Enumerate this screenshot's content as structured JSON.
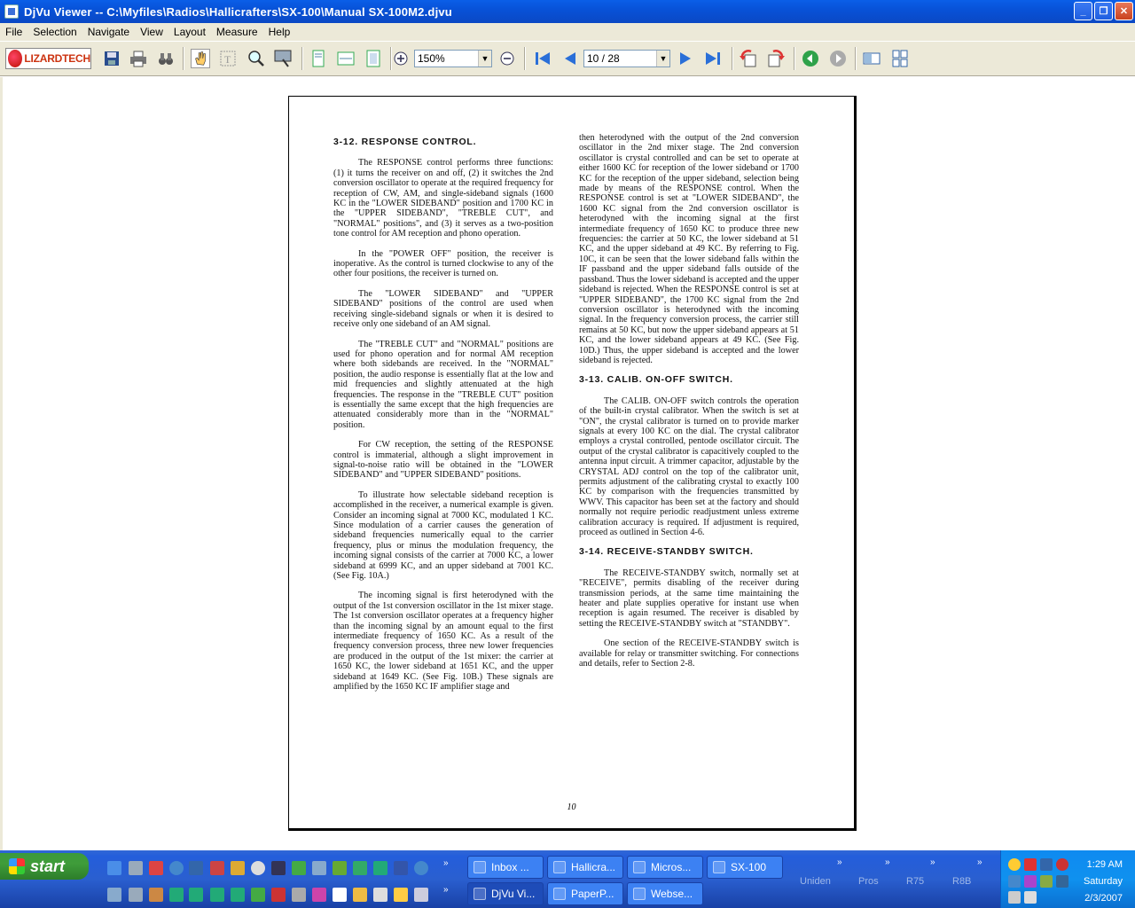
{
  "window": {
    "title": "DjVu Viewer -- C:\\Myfiles\\Radios\\Hallicrafters\\SX-100\\Manual SX-100M2.djvu",
    "minimize": "_",
    "maximize": "❐",
    "close": "✕"
  },
  "menu": [
    "File",
    "Selection",
    "Navigate",
    "View",
    "Layout",
    "Measure",
    "Help"
  ],
  "toolbar": {
    "logo_text": "LIZARDTECH",
    "zoom_value": "150%",
    "page_value": "10 / 28"
  },
  "document": {
    "page_number": "10",
    "left_column": [
      {
        "type": "h",
        "text": "3-12.  RESPONSE CONTROL."
      },
      {
        "type": "p",
        "text": "The RESPONSE control performs three functions: (1) it turns the receiver on and off, (2) it switches the 2nd conversion oscillator to operate at the required frequency for reception of CW, AM, and single-sideband signals (1600 KC in the \"LOWER SIDEBAND\" position and 1700 KC in the \"UPPER SIDEBAND\", \"TREBLE CUT\", and \"NORMAL\" positions\", and (3) it serves as a two-position tone control for AM reception and phono operation."
      },
      {
        "type": "p",
        "text": "In the \"POWER OFF\" position, the receiver is inoperative. As the control is turned clockwise to any of the other four positions, the receiver is turned on."
      },
      {
        "type": "p",
        "text": "The \"LOWER SIDEBAND\" and \"UPPER SIDEBAND\" positions of the control are used when receiving single-sideband signals or when it is desired to receive only one sideband of an AM signal."
      },
      {
        "type": "p",
        "text": "The \"TREBLE CUT\" and \"NORMAL\" positions are used for phono operation and for normal AM reception where both sidebands are received. In the \"NORMAL\" position, the audio response is essentially flat at the low and mid frequencies and slightly attenuated at the high frequencies. The response in the \"TREBLE CUT\" position is essentially the same except that the high frequencies are attenuated considerably more than in the \"NORMAL\" position."
      },
      {
        "type": "p",
        "text": "For CW reception, the setting of the RESPONSE control is immaterial, although a slight improvement in signal-to-noise ratio will be obtained in the \"LOWER SIDEBAND\" and \"UPPER SIDEBAND\" positions."
      },
      {
        "type": "p",
        "text": "To illustrate how selectable sideband reception is accomplished in the receiver, a numerical example is given. Consider an incoming signal at 7000 KC, modulated 1 KC. Since modulation of a carrier causes the generation of sideband frequencies numerically equal to the carrier frequency, plus or minus the modulation frequency, the incoming signal consists of the carrier at 7000 KC, a lower sideband at 6999 KC, and an upper sideband at 7001 KC. (See Fig. 10A.)"
      },
      {
        "type": "p",
        "text": "The incoming signal is first heterodyned with the output of the 1st conversion oscillator in the 1st mixer stage. The 1st conversion oscillator operates at a frequency higher than the incoming signal by an amount equal to the first intermediate frequency of 1650 KC. As a result of the frequency conversion process, three new lower frequencies are produced in the output of the 1st mixer: the carrier at 1650 KC, the lower sideband at 1651 KC, and the upper sideband at 1649 KC. (See Fig. 10B.) These signals are amplified by the 1650 KC IF amplifier stage and"
      }
    ],
    "right_column": [
      {
        "type": "p0",
        "text": "then heterodyned with the output of the 2nd conversion oscillator in the 2nd mixer stage. The 2nd conversion oscillator is crystal controlled and can be set to operate at either 1600 KC for reception of the lower sideband or 1700 KC for the reception of the upper sideband, selection being made by means of the RESPONSE control. When the RESPONSE control is set at \"LOWER SIDEBAND\", the 1600 KC signal from the 2nd conversion oscillator is heterodyned with the incoming signal at the first intermediate frequency of 1650 KC to produce three new frequencies: the carrier at 50 KC, the lower sideband at 51 KC, and the upper sideband at 49 KC. By referring to Fig. 10C, it can be seen that the lower sideband falls within the IF passband and the upper sideband falls outside of the passband. Thus the lower sideband is accepted and the upper sideband is rejected. When the RESPONSE control is set at \"UPPER SIDEBAND\", the 1700 KC signal from the 2nd conversion oscillator is heterodyned with the incoming signal. In the frequency conversion process, the carrier still remains at 50 KC, but now the upper sideband appears at 51 KC, and the lower sideband appears at 49 KC. (See Fig. 10D.) Thus, the upper sideband is accepted and the lower sideband is rejected."
      },
      {
        "type": "h",
        "text": "3-13.  CALIB. ON-OFF SWITCH."
      },
      {
        "type": "p",
        "text": "The CALIB. ON-OFF switch controls the operation of the built-in crystal calibrator. When the switch is set at \"ON\", the crystal calibrator is turned on to provide marker signals at every 100 KC on the dial. The crystal calibrator employs a crystal controlled, pentode oscillator circuit. The output of the crystal calibrator is capacitively coupled to the antenna input circuit. A trimmer capacitor, adjustable by the CRYSTAL ADJ control on the top of the calibrator unit, permits adjustment of the calibrating crystal to exactly 100 KC by comparison with the frequencies transmitted by WWV. This capacitor has been set at the factory and should normally not require periodic readjustment unless extreme calibration accuracy is required. If adjustment is required, proceed as outlined in Section 4-6."
      },
      {
        "type": "h",
        "text": "3-14.  RECEIVE-STANDBY SWITCH."
      },
      {
        "type": "p",
        "text": "The RECEIVE-STANDBY switch, normally set at \"RECEIVE\", permits disabling of the receiver during transmission periods, at the same time maintaining the heater and plate supplies operative for instant use when reception is again resumed. The receiver is disabled by setting the RECEIVE-STANDBY switch at \"STANDBY\"."
      },
      {
        "type": "p",
        "text": "One section of the RECEIVE-STANDBY switch is available for relay or transmitter switching. For connections and details, refer to Section 2-8."
      }
    ]
  },
  "taskbar": {
    "start_label": "start",
    "chevron": "»",
    "tasks_top": [
      "Inbox ...",
      "Hallicra...",
      "Micros...",
      "SX-100"
    ],
    "tasks_bottom": [
      "DjVu Vi...",
      "PaperP...",
      "Webse..."
    ],
    "groups": [
      "Uniden",
      "Pros",
      "R75",
      "R8B"
    ],
    "clock": {
      "time": "1:29 AM",
      "day": "Saturday",
      "date": "2/3/2007"
    }
  },
  "colors": {
    "titlebar": "#0a5fe8",
    "chrome": "#ece9d8",
    "taskbar": "#245edb",
    "start": "#3f9c3a",
    "tray": "#0f91ef"
  }
}
